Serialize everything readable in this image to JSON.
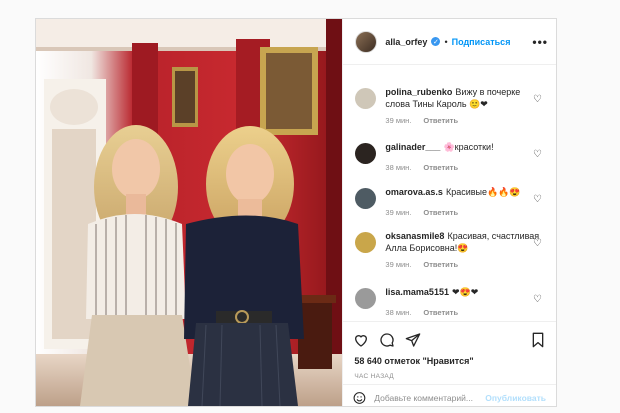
{
  "header": {
    "username": "alla_orfey",
    "separator": "•",
    "follow_label": "Подписаться",
    "more_label": "•••"
  },
  "comments": [
    {
      "user": "polina_rubenko",
      "text": "Вижу в почерке слова Тины Кароль 🙂❤",
      "time": "39 мин.",
      "reply": "Ответить",
      "avatar_color": "#cfc7b8"
    },
    {
      "user": "galinader___",
      "text": "🌸красотки!",
      "time": "38 мин.",
      "reply": "Ответить",
      "avatar_color": "#2b2420"
    },
    {
      "user": "omarova.as.s",
      "text": "Красивые🔥🔥😍",
      "time": "39 мин.",
      "reply": "Ответить",
      "avatar_color": "#4e5b63"
    },
    {
      "user": "oksanasmile8",
      "text": "Красивая, счастливая Алла Борисовна!😍",
      "time": "39 мин.",
      "reply": "Ответить",
      "avatar_color": "#c9a64a"
    },
    {
      "user": "lisa.mama5151",
      "text": "❤😍❤",
      "time": "38 мин.",
      "reply": "Ответить",
      "avatar_color": "#9a9a9a"
    }
  ],
  "likes": "58 640 отметок \"Нравится\"",
  "time_ago": "ЧАС НАЗАД",
  "add_comment": {
    "placeholder": "Добавьте комментарий...",
    "publish_label": "Опубликовать"
  },
  "icons": [
    "heart-icon",
    "comment-icon",
    "share-icon",
    "bookmark-icon",
    "emoji-icon",
    "verified-icon",
    "more-icon"
  ],
  "colors": {
    "accent": "#0095f6",
    "publish_disabled": "#b2dffc",
    "border": "#dbdbdb",
    "meta": "#8e8e8e"
  }
}
